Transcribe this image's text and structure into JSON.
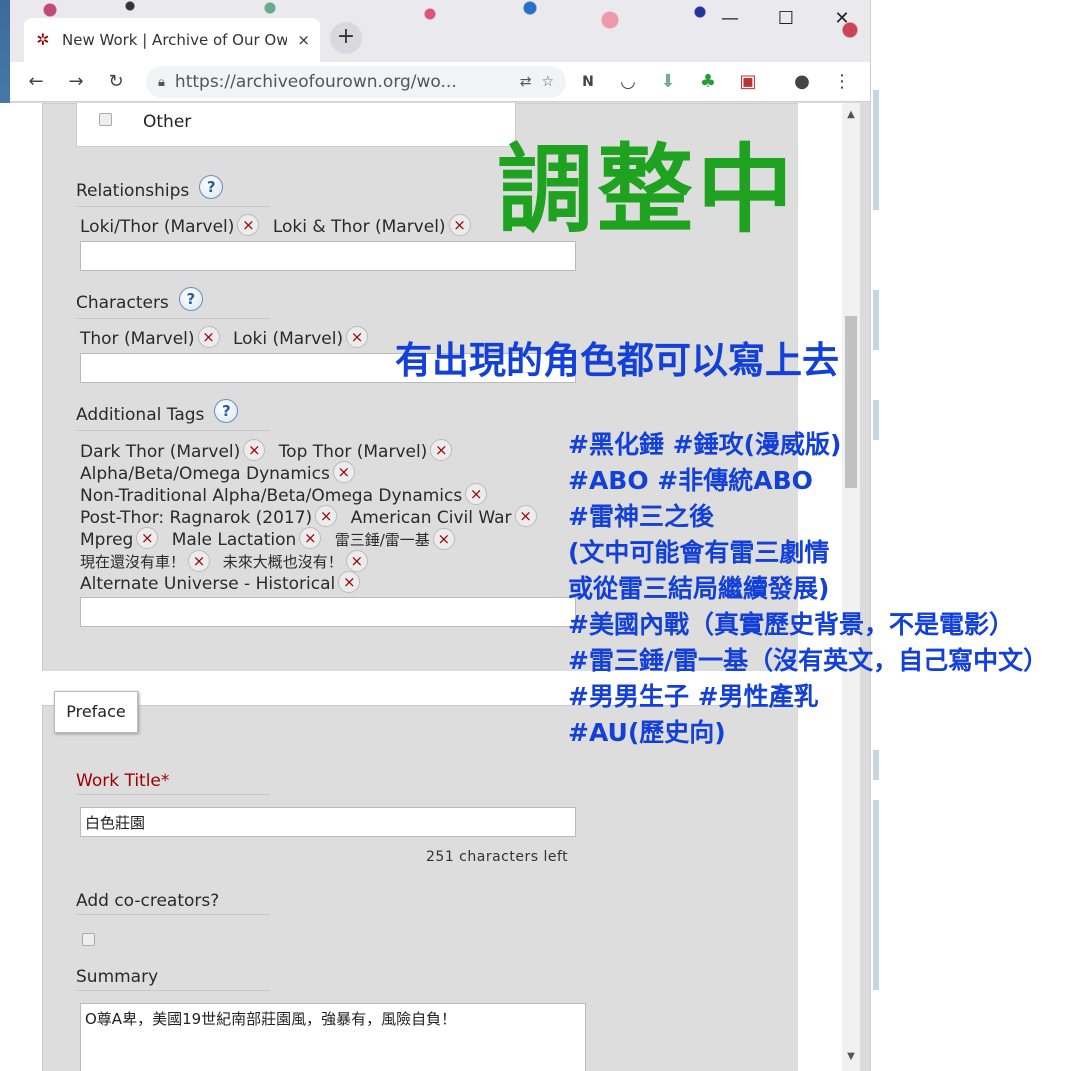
{
  "browser": {
    "tab_title": "New Work | Archive of Our Ow",
    "tab_close": "×",
    "new_tab": "+",
    "url": "https://archiveofourown.org/wo...",
    "win_min": "—",
    "win_max": "☐",
    "win_close": "✕",
    "back": "←",
    "forward": "→",
    "reload": "↻"
  },
  "tags_section": {
    "other_label": "Other",
    "relationships": {
      "label": "Relationships",
      "help": "?",
      "tags": [
        "Loki/Thor (Marvel)",
        "Loki & Thor (Marvel)"
      ]
    },
    "characters": {
      "label": "Characters",
      "help": "?",
      "tags": [
        "Thor (Marvel)",
        "Loki (Marvel)"
      ]
    },
    "additional": {
      "label": "Additional Tags",
      "help": "?",
      "rows": [
        [
          "Dark Thor (Marvel)",
          "Top Thor (Marvel)"
        ],
        [
          "Alpha/Beta/Omega Dynamics"
        ],
        [
          "Non-Traditional Alpha/Beta/Omega Dynamics"
        ],
        [
          "Post-Thor: Ragnarok (2017)",
          "American Civil War"
        ],
        [
          "Mpreg",
          "Male Lactation",
          "雷三錘/雷一基"
        ],
        [
          "現在還沒有車！",
          "未來大概也沒有！"
        ],
        [
          "Alternate Universe - Historical"
        ]
      ]
    },
    "remove_glyph": "×"
  },
  "preface": {
    "legend": "Preface",
    "work_title_label": "Work Title*",
    "work_title_value": "白色莊園",
    "chars_left": "251 characters left",
    "cocreators_label": "Add co-creators?",
    "summary_label": "Summary",
    "summary_value": "O尊A卑，美國19世紀南部莊園風，強暴有，風險自負！"
  },
  "annotations": {
    "status": "調整中",
    "characters_note": "有出現的角色都可以寫上去",
    "tags_note": [
      "#黑化錘 #錘攻(漫威版)",
      "#ABO #非傳統ABO",
      "#雷神三之後",
      "(文中可能會有雷三劇情",
      "或從雷三結局繼續發展)",
      "#美國內戰（真實歷史背景，不是電影）",
      "#雷三錘/雷一基（沒有英文，自己寫中文）",
      "#男男生子 #男性產乳",
      "#AU(歷史向)"
    ]
  },
  "colors": {
    "status_green": "#1fa21f",
    "annotation_blue": "#1340d8",
    "required_red": "#990000",
    "panel_gray": "#dddddd"
  }
}
